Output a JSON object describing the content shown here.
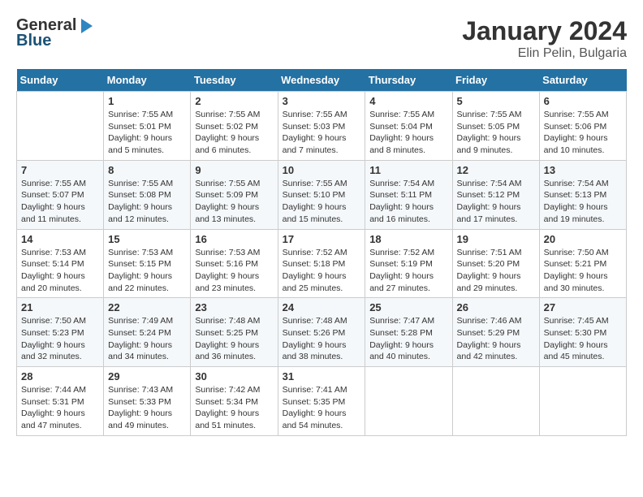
{
  "logo": {
    "general": "General",
    "blue": "Blue"
  },
  "title": "January 2024",
  "subtitle": "Elin Pelin, Bulgaria",
  "days_header": [
    "Sunday",
    "Monday",
    "Tuesday",
    "Wednesday",
    "Thursday",
    "Friday",
    "Saturday"
  ],
  "weeks": [
    [
      {
        "day": "",
        "sunrise": "",
        "sunset": "",
        "daylight": ""
      },
      {
        "day": "1",
        "sunrise": "Sunrise: 7:55 AM",
        "sunset": "Sunset: 5:01 PM",
        "daylight": "Daylight: 9 hours and 5 minutes."
      },
      {
        "day": "2",
        "sunrise": "Sunrise: 7:55 AM",
        "sunset": "Sunset: 5:02 PM",
        "daylight": "Daylight: 9 hours and 6 minutes."
      },
      {
        "day": "3",
        "sunrise": "Sunrise: 7:55 AM",
        "sunset": "Sunset: 5:03 PM",
        "daylight": "Daylight: 9 hours and 7 minutes."
      },
      {
        "day": "4",
        "sunrise": "Sunrise: 7:55 AM",
        "sunset": "Sunset: 5:04 PM",
        "daylight": "Daylight: 9 hours and 8 minutes."
      },
      {
        "day": "5",
        "sunrise": "Sunrise: 7:55 AM",
        "sunset": "Sunset: 5:05 PM",
        "daylight": "Daylight: 9 hours and 9 minutes."
      },
      {
        "day": "6",
        "sunrise": "Sunrise: 7:55 AM",
        "sunset": "Sunset: 5:06 PM",
        "daylight": "Daylight: 9 hours and 10 minutes."
      }
    ],
    [
      {
        "day": "7",
        "sunrise": "Sunrise: 7:55 AM",
        "sunset": "Sunset: 5:07 PM",
        "daylight": "Daylight: 9 hours and 11 minutes."
      },
      {
        "day": "8",
        "sunrise": "Sunrise: 7:55 AM",
        "sunset": "Sunset: 5:08 PM",
        "daylight": "Daylight: 9 hours and 12 minutes."
      },
      {
        "day": "9",
        "sunrise": "Sunrise: 7:55 AM",
        "sunset": "Sunset: 5:09 PM",
        "daylight": "Daylight: 9 hours and 13 minutes."
      },
      {
        "day": "10",
        "sunrise": "Sunrise: 7:55 AM",
        "sunset": "Sunset: 5:10 PM",
        "daylight": "Daylight: 9 hours and 15 minutes."
      },
      {
        "day": "11",
        "sunrise": "Sunrise: 7:54 AM",
        "sunset": "Sunset: 5:11 PM",
        "daylight": "Daylight: 9 hours and 16 minutes."
      },
      {
        "day": "12",
        "sunrise": "Sunrise: 7:54 AM",
        "sunset": "Sunset: 5:12 PM",
        "daylight": "Daylight: 9 hours and 17 minutes."
      },
      {
        "day": "13",
        "sunrise": "Sunrise: 7:54 AM",
        "sunset": "Sunset: 5:13 PM",
        "daylight": "Daylight: 9 hours and 19 minutes."
      }
    ],
    [
      {
        "day": "14",
        "sunrise": "Sunrise: 7:53 AM",
        "sunset": "Sunset: 5:14 PM",
        "daylight": "Daylight: 9 hours and 20 minutes."
      },
      {
        "day": "15",
        "sunrise": "Sunrise: 7:53 AM",
        "sunset": "Sunset: 5:15 PM",
        "daylight": "Daylight: 9 hours and 22 minutes."
      },
      {
        "day": "16",
        "sunrise": "Sunrise: 7:53 AM",
        "sunset": "Sunset: 5:16 PM",
        "daylight": "Daylight: 9 hours and 23 minutes."
      },
      {
        "day": "17",
        "sunrise": "Sunrise: 7:52 AM",
        "sunset": "Sunset: 5:18 PM",
        "daylight": "Daylight: 9 hours and 25 minutes."
      },
      {
        "day": "18",
        "sunrise": "Sunrise: 7:52 AM",
        "sunset": "Sunset: 5:19 PM",
        "daylight": "Daylight: 9 hours and 27 minutes."
      },
      {
        "day": "19",
        "sunrise": "Sunrise: 7:51 AM",
        "sunset": "Sunset: 5:20 PM",
        "daylight": "Daylight: 9 hours and 29 minutes."
      },
      {
        "day": "20",
        "sunrise": "Sunrise: 7:50 AM",
        "sunset": "Sunset: 5:21 PM",
        "daylight": "Daylight: 9 hours and 30 minutes."
      }
    ],
    [
      {
        "day": "21",
        "sunrise": "Sunrise: 7:50 AM",
        "sunset": "Sunset: 5:23 PM",
        "daylight": "Daylight: 9 hours and 32 minutes."
      },
      {
        "day": "22",
        "sunrise": "Sunrise: 7:49 AM",
        "sunset": "Sunset: 5:24 PM",
        "daylight": "Daylight: 9 hours and 34 minutes."
      },
      {
        "day": "23",
        "sunrise": "Sunrise: 7:48 AM",
        "sunset": "Sunset: 5:25 PM",
        "daylight": "Daylight: 9 hours and 36 minutes."
      },
      {
        "day": "24",
        "sunrise": "Sunrise: 7:48 AM",
        "sunset": "Sunset: 5:26 PM",
        "daylight": "Daylight: 9 hours and 38 minutes."
      },
      {
        "day": "25",
        "sunrise": "Sunrise: 7:47 AM",
        "sunset": "Sunset: 5:28 PM",
        "daylight": "Daylight: 9 hours and 40 minutes."
      },
      {
        "day": "26",
        "sunrise": "Sunrise: 7:46 AM",
        "sunset": "Sunset: 5:29 PM",
        "daylight": "Daylight: 9 hours and 42 minutes."
      },
      {
        "day": "27",
        "sunrise": "Sunrise: 7:45 AM",
        "sunset": "Sunset: 5:30 PM",
        "daylight": "Daylight: 9 hours and 45 minutes."
      }
    ],
    [
      {
        "day": "28",
        "sunrise": "Sunrise: 7:44 AM",
        "sunset": "Sunset: 5:31 PM",
        "daylight": "Daylight: 9 hours and 47 minutes."
      },
      {
        "day": "29",
        "sunrise": "Sunrise: 7:43 AM",
        "sunset": "Sunset: 5:33 PM",
        "daylight": "Daylight: 9 hours and 49 minutes."
      },
      {
        "day": "30",
        "sunrise": "Sunrise: 7:42 AM",
        "sunset": "Sunset: 5:34 PM",
        "daylight": "Daylight: 9 hours and 51 minutes."
      },
      {
        "day": "31",
        "sunrise": "Sunrise: 7:41 AM",
        "sunset": "Sunset: 5:35 PM",
        "daylight": "Daylight: 9 hours and 54 minutes."
      },
      {
        "day": "",
        "sunrise": "",
        "sunset": "",
        "daylight": ""
      },
      {
        "day": "",
        "sunrise": "",
        "sunset": "",
        "daylight": ""
      },
      {
        "day": "",
        "sunrise": "",
        "sunset": "",
        "daylight": ""
      }
    ]
  ]
}
